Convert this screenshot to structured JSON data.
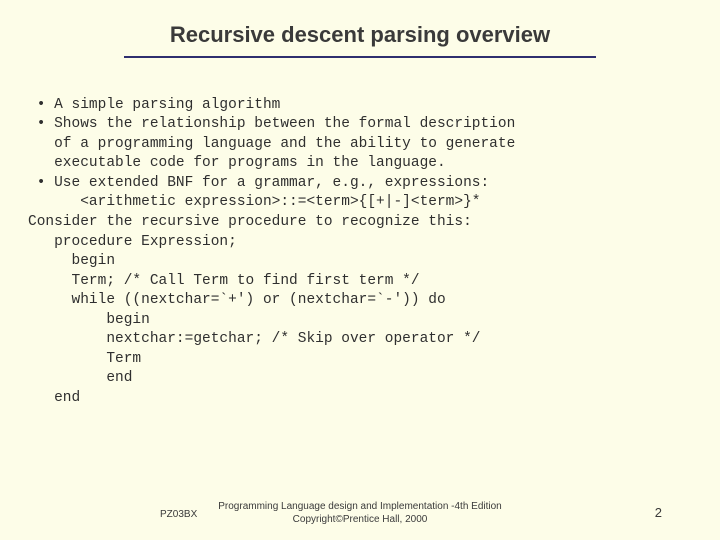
{
  "title": "Recursive descent parsing overview",
  "lines": {
    "l0": " • A simple parsing algorithm",
    "l1": " • Shows the relationship between the formal description",
    "l2": "   of a programming language and the ability to generate",
    "l3": "   executable code for programs in the language.",
    "l4": " • Use extended BNF for a grammar, e.g., expressions:",
    "l5": "      <arithmetic expression>::=<term>{[+|-]<term>}*",
    "l6": "Consider the recursive procedure to recognize this:",
    "l7": "   procedure Expression;",
    "l8": "     begin",
    "l9": "     Term; /* Call Term to find first term */",
    "l10": "     while ((nextchar=`+') or (nextchar=`-')) do",
    "l11": "         begin",
    "l12": "         nextchar:=getchar; /* Skip over operator */",
    "l13": "         Term",
    "l14": "         end",
    "l15": "   end"
  },
  "footer": {
    "code": "PZ03BX",
    "credit1": "Programming Language design and Implementation -4th Edition",
    "credit2": "Copyright©Prentice Hall, 2000",
    "page": "2"
  }
}
